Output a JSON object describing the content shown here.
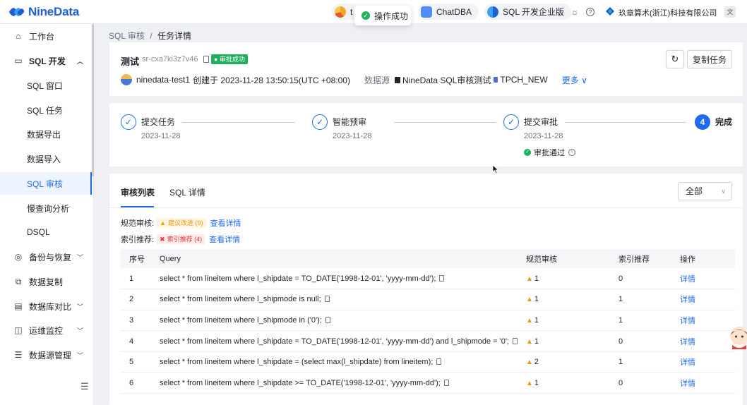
{
  "app": {
    "logo_text": "NineData"
  },
  "topbar": {
    "toast": "操作成功",
    "pill_partial": "t",
    "chatdba": "ChatDBA",
    "sql_edition": "SQL 开发企业版",
    "org": "玖章算术(浙江)科技有限公司"
  },
  "sidebar": {
    "items": [
      {
        "label": "工作台",
        "icon": "home-icon"
      },
      {
        "label": "SQL 开发",
        "icon": "terminal-icon"
      },
      {
        "label": "SQL 窗口"
      },
      {
        "label": "SQL 任务"
      },
      {
        "label": "数据导出"
      },
      {
        "label": "数据导入"
      },
      {
        "label": "SQL 审核"
      },
      {
        "label": "慢查询分析"
      },
      {
        "label": "DSQL"
      },
      {
        "label": "备份与恢复",
        "icon": "backup-icon"
      },
      {
        "label": "数据复制",
        "icon": "copy-icon"
      },
      {
        "label": "数据库对比",
        "icon": "compare-icon"
      },
      {
        "label": "运维监控",
        "icon": "monitor-icon"
      },
      {
        "label": "数据源管理",
        "icon": "datasource-icon"
      }
    ]
  },
  "breadcrumb": {
    "parent": "SQL 审核",
    "sep": "/",
    "current": "任务详情"
  },
  "task": {
    "title": "测试",
    "id": "sr-cxa7ki3z7v46",
    "status": "审批成功",
    "creator": "ninedata-test1",
    "created_text": "创建于 2023-11-28 13:50:15(UTC +08:00)",
    "datasource_label": "数据源",
    "datasource": "NineData SQL审核测试",
    "database": "TPCH_NEW",
    "more": "更多",
    "copy_button": "复制任务"
  },
  "steps": [
    {
      "label": "提交任务",
      "date": "2023-11-28"
    },
    {
      "label": "智能预审",
      "date": "2023-11-28"
    },
    {
      "label": "提交审批",
      "date": "2023-11-28",
      "note": "审批通过"
    },
    {
      "num": "4",
      "label": "完成"
    }
  ],
  "tabs": {
    "review_list": "审核列表",
    "sql_detail": "SQL 详情"
  },
  "filter": {
    "selected": "全部"
  },
  "rules": {
    "spec_label": "规范审核:",
    "spec_tag": "建议改进 (9)",
    "index_label": "索引推荐:",
    "index_tag": "索引推荐 (4)",
    "view_detail": "查看详情"
  },
  "table": {
    "headers": [
      "序号",
      "Query",
      "规范审核",
      "索引推荐",
      "操作"
    ],
    "rows": [
      {
        "no": "1",
        "query": "select * from lineitem where l_shipdate = TO_DATE('1998-12-01', 'yyyy-mm-dd');",
        "spec": "1",
        "index": "0",
        "action": "详情"
      },
      {
        "no": "2",
        "query": "select * from lineitem where l_shipmode is null;",
        "spec": "1",
        "index": "1",
        "action": "详情"
      },
      {
        "no": "3",
        "query": "select * from lineitem where l_shipmode in ('0');",
        "spec": "1",
        "index": "1",
        "action": "详情"
      },
      {
        "no": "4",
        "query": "select * from lineitem where l_shipdate = TO_DATE('1998-12-01', 'yyyy-mm-dd') and l_shipmode = '0';",
        "spec": "1",
        "index": "0",
        "action": "详情"
      },
      {
        "no": "5",
        "query": "select * from lineitem where l_shipdate = (select max(l_shipdate) from lineitem);",
        "spec": "2",
        "index": "1",
        "action": "详情"
      },
      {
        "no": "6",
        "query": "select * from lineitem where l_shipdate >= TO_DATE('1998-12-01', 'yyyy-mm-dd');",
        "spec": "1",
        "index": "0",
        "action": "详情"
      }
    ]
  },
  "colors": {
    "primary": "#1f6bf0",
    "success": "#1eb05a",
    "warning": "#e89b10",
    "danger": "#e03b3b"
  }
}
